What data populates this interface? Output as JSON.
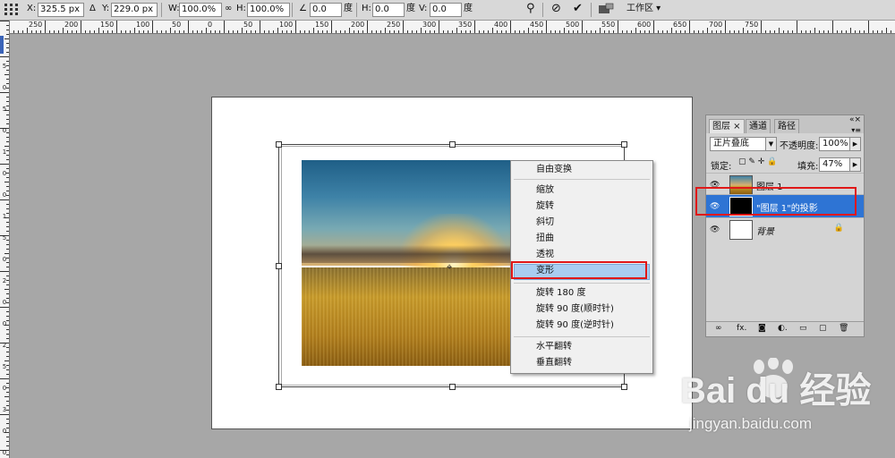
{
  "options_bar": {
    "x_label": "X:",
    "x_value": "325.5 px",
    "delta": "Δ",
    "y_label": "Y:",
    "y_value": "229.0 px",
    "w_label": "W:",
    "w_value": "100.0%",
    "link": "∞",
    "h_label": "H:",
    "h_value": "100.0%",
    "angle_icon": "∠",
    "rot_value": "0.0",
    "rot_unit": "度",
    "hskew_label": "H:",
    "hskew_value": "0.0",
    "hskew_unit": "度",
    "vskew_label": "V:",
    "vskew_value": "0.0",
    "vskew_unit": "度",
    "workspace": "工作区 ▾"
  },
  "ruler": {
    "top": [
      "250",
      "200",
      "150",
      "100",
      "50",
      "0",
      "50",
      "100",
      "150",
      "200",
      "250",
      "300",
      "350",
      "400",
      "450",
      "500",
      "550",
      "600",
      "650",
      "700",
      "750"
    ],
    "left": [
      "5",
      "0",
      "5",
      "0",
      "1",
      "0",
      "0",
      "1",
      "5",
      "0",
      "2",
      "0",
      "0",
      "2",
      "5",
      "0",
      "3",
      "0",
      "0"
    ]
  },
  "context_menu": {
    "items": [
      {
        "label": "自由变换"
      },
      {
        "label": "缩放"
      },
      {
        "label": "旋转"
      },
      {
        "label": "斜切"
      },
      {
        "label": "扭曲"
      },
      {
        "label": "透视"
      },
      {
        "label": "变形"
      },
      {
        "label": "旋转 180 度"
      },
      {
        "label": "旋转 90 度(顺时针)"
      },
      {
        "label": "旋转 90 度(逆时针)"
      },
      {
        "label": "水平翻转"
      },
      {
        "label": "垂直翻转"
      }
    ],
    "highlighted": "变形"
  },
  "layers_panel": {
    "tabs": [
      "图层 ×",
      "通道",
      "路径"
    ],
    "blend_mode": "正片叠底",
    "opacity_label": "不透明度:",
    "opacity_value": "100%",
    "lock_label": "锁定:",
    "fill_label": "填充:",
    "fill_value": "47%",
    "layers": [
      {
        "name": "图层 1"
      },
      {
        "name": "\"图层 1\"的投影"
      },
      {
        "name": "背景"
      }
    ],
    "bottom_icons": [
      "∞",
      "fx.",
      "◙",
      "◐.",
      "▭",
      "▢",
      "🗑"
    ]
  },
  "watermark": {
    "brand": "Bai du 经验",
    "url": "jingyan.baidu.com"
  },
  "colors": {
    "highlight": "#a9cdf0",
    "layer_selected": "#2e74d4",
    "annotation": "#e01818"
  }
}
